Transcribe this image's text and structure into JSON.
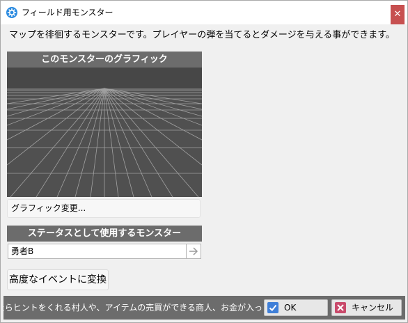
{
  "window": {
    "title": "フィールド用モンスター",
    "close_glyph": "✕"
  },
  "description": "マップを徘徊するモンスターです。プレイヤーの弾を当てるとダメージを与える事ができます。",
  "graphic_section": {
    "header": "このモンスターのグラフィック",
    "change_button": "グラフィック変更..."
  },
  "status_section": {
    "header": "ステータスとして使用するモンスター",
    "selected_monster": "勇者B"
  },
  "advanced_button": "高度なイベントに変換",
  "footer": {
    "hint": "かけたらヒントをくれる村人や、アイテムの売買ができる商人、お金が入っ",
    "ok_label": "OK",
    "cancel_label": "キャンセル"
  },
  "icons": {
    "app": "gear-icon",
    "close": "close-icon",
    "arrow": "arrow-right-icon",
    "ok": "checkmark-icon",
    "cancel": "x-icon"
  },
  "colors": {
    "header_bg": "#6c6c6c",
    "close_bg": "#c75050",
    "ok_icon": "#3f7fd8",
    "cancel_icon": "#c94a6b",
    "preview_bg": "#515151"
  }
}
